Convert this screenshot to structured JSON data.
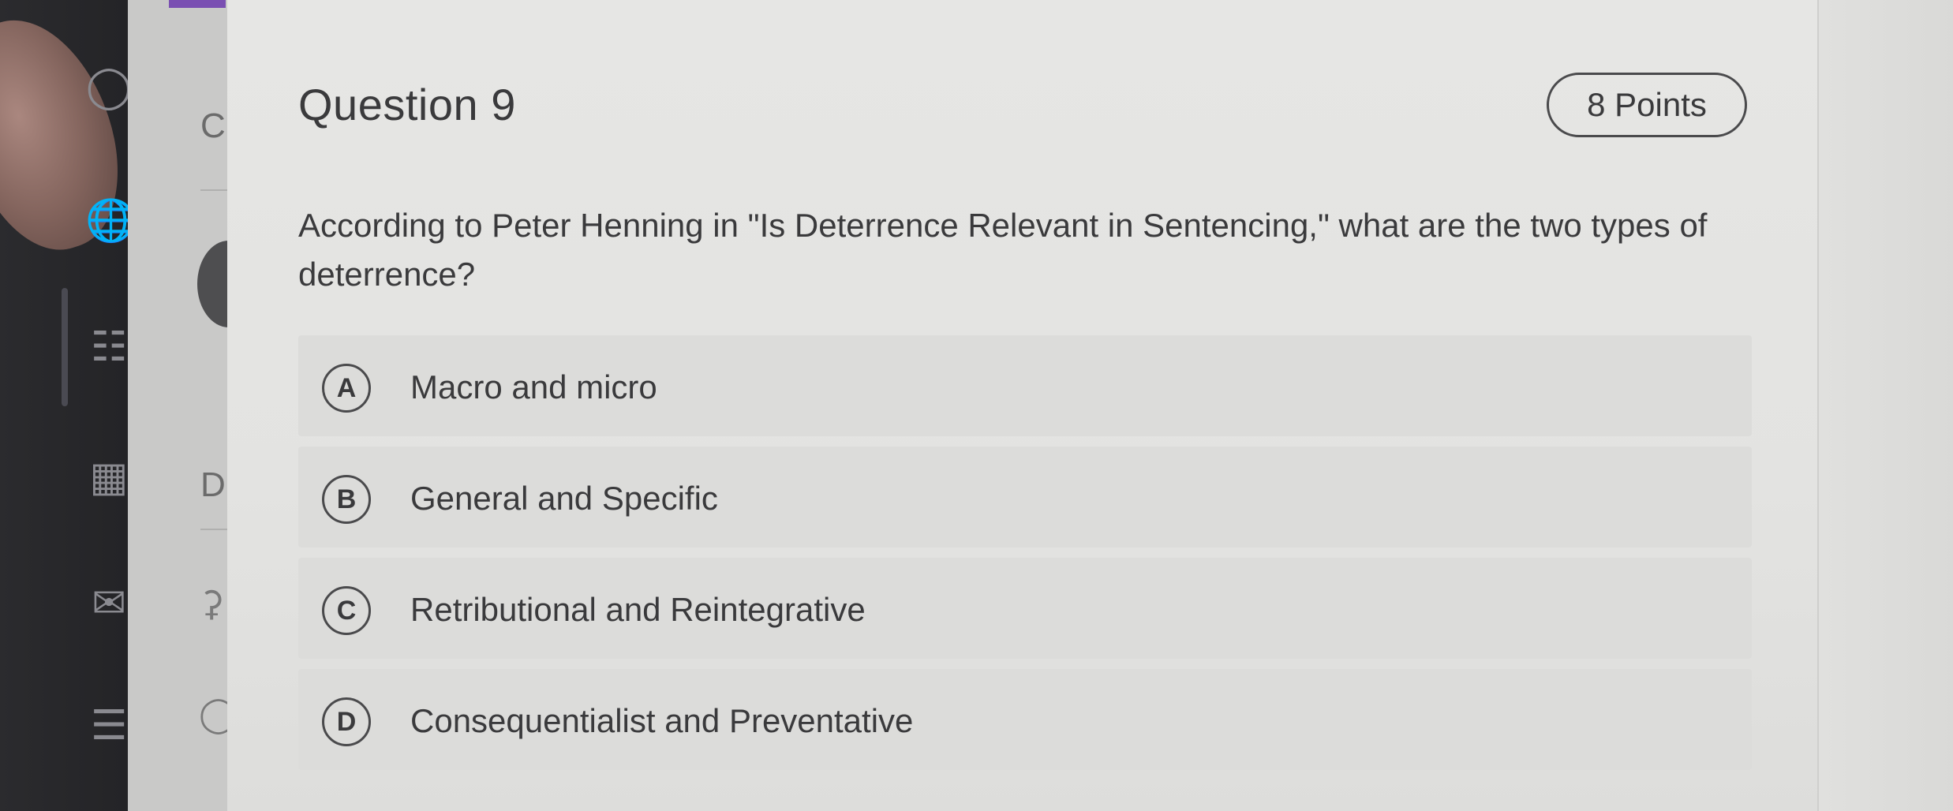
{
  "nav": {
    "letters": [
      "C",
      "D"
    ]
  },
  "question": {
    "title": "Question 9",
    "points": "8 Points",
    "text": "According to Peter Henning in \"Is Deterrence Relevant in Sentencing,\" what are the two types of deterrence?"
  },
  "options": [
    {
      "letter": "A",
      "label": "Macro and micro"
    },
    {
      "letter": "B",
      "label": "General and Specific"
    },
    {
      "letter": "C",
      "label": "Retributional and Reintegrative"
    },
    {
      "letter": "D",
      "label": "Consequentialist and Preventative"
    }
  ],
  "icons": {
    "rail": [
      "people-icon",
      "globe-icon",
      "board-icon",
      "calendar-icon",
      "mail-icon",
      "document-icon"
    ]
  }
}
